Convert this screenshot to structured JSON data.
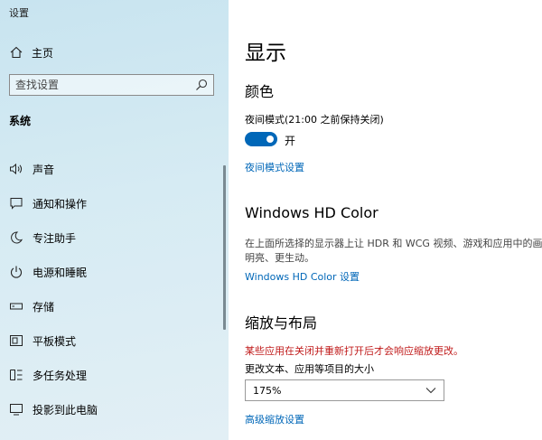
{
  "window": {
    "title": "设置"
  },
  "sidebar": {
    "home_label": "主页",
    "search_placeholder": "查找设置",
    "section_label": "系统",
    "items": [
      {
        "label": "声音",
        "icon": "speaker-icon"
      },
      {
        "label": "通知和操作",
        "icon": "notification-icon"
      },
      {
        "label": "专注助手",
        "icon": "moon-icon"
      },
      {
        "label": "电源和睡眠",
        "icon": "power-icon"
      },
      {
        "label": "存储",
        "icon": "storage-icon"
      },
      {
        "label": "平板模式",
        "icon": "tablet-mode-icon"
      },
      {
        "label": "多任务处理",
        "icon": "multitasking-icon"
      },
      {
        "label": "投影到此电脑",
        "icon": "project-icon"
      }
    ]
  },
  "main": {
    "title": "显示",
    "color_section": {
      "heading": "颜色",
      "night_light_label": "夜间模式(21:00 之前保持关闭)",
      "toggle_state": "开",
      "night_light_settings_link": "夜间模式设置"
    },
    "hdr_section": {
      "heading": "Windows HD Color",
      "description_line1": "在上面所选择的显示器上让 HDR 和 WCG 视频、游戏和应用中的画面更",
      "description_line2": "明亮、更生动。",
      "settings_link": "Windows HD Color 设置"
    },
    "scale_section": {
      "heading": "缩放与布局",
      "warning": "某些应用在关闭并重新打开后才会响应缩放更改。",
      "size_label": "更改文本、应用等项目的大小",
      "size_value": "175%",
      "advanced_link": "高级缩放设置"
    }
  },
  "colors": {
    "accent": "#0067b8",
    "warning": "#c01b1b"
  }
}
